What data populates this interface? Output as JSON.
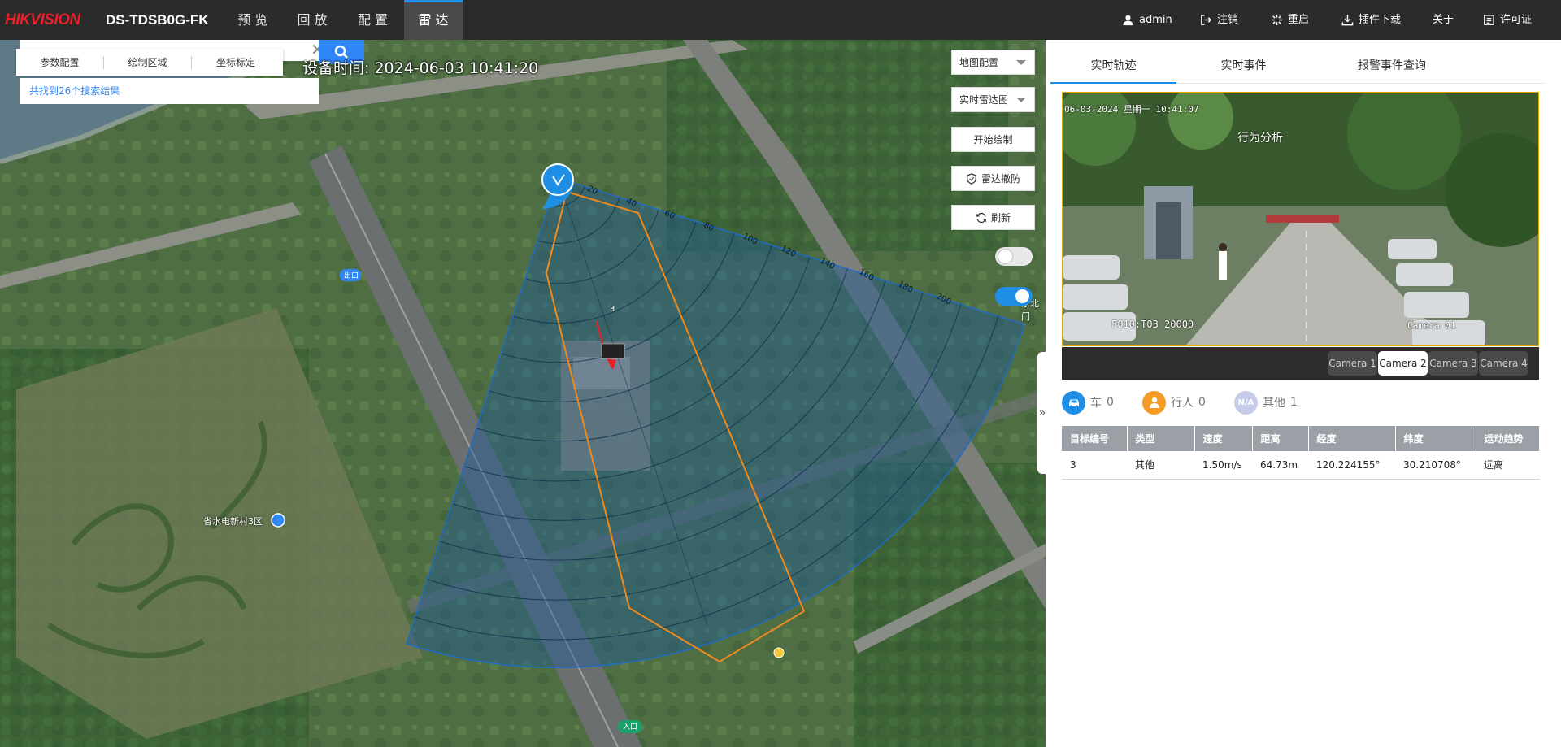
{
  "topbar": {
    "logo": "HIKVISION",
    "model": "DS-TDSB0G-FK",
    "tabs": [
      {
        "label": "预 览"
      },
      {
        "label": "回 放"
      },
      {
        "label": "配 置"
      },
      {
        "label": "雷 达"
      }
    ],
    "active_tab": "雷 达",
    "right": {
      "user": "admin",
      "logout": "注销",
      "reboot": "重启",
      "plugin": "插件下载",
      "about": "关于",
      "license": "许可证"
    }
  },
  "map": {
    "search": {
      "value": "",
      "placeholder": ""
    },
    "tools": [
      "参数配置",
      "绘制区域",
      "坐标标定"
    ],
    "results": "共找到26个搜索结果",
    "device_time": "设备时间: 2024-06-03 10:41:20",
    "controls": {
      "map_config": "地图配置",
      "radar_view": "实时雷达图",
      "start_draw": "开始绘制",
      "disarm": "雷达撤防",
      "refresh": "刷新"
    },
    "toggles": [
      {
        "state": "off"
      },
      {
        "state": "on"
      }
    ],
    "labels": {
      "exit": "出口",
      "entrance": "入口",
      "poi": "省水电新村3区",
      "north_gate": "东北门",
      "target_id": "3"
    },
    "ring_labels": [
      "20",
      "40",
      "60",
      "80",
      "100",
      "120",
      "140",
      "160",
      "180",
      "200"
    ],
    "colors": {
      "zone_fill": "#1e5a96",
      "zone_stroke": "#1f6cc4",
      "polygon": "#f08a1c",
      "target": "#e8202a"
    }
  },
  "panel": {
    "tabs": [
      "实时轨迹",
      "实时事件",
      "报警事件查询"
    ],
    "active_tab": "实时轨迹",
    "video": {
      "timestamp": "06-03-2024 星期一 10:41:07",
      "overlay_mid": "行为分析",
      "bottom_left": "F010:T03 20000",
      "camera_label": "Camera 01"
    },
    "cameras": [
      "Camera 1",
      "Camera 2",
      "Camera 3",
      "Camera 4"
    ],
    "active_camera": "Camera 2",
    "stats": [
      {
        "label": "车",
        "count": "0",
        "icon": "car-icon",
        "color": "#1f8fe5"
      },
      {
        "label": "行人",
        "count": "0",
        "icon": "person-icon",
        "color": "#f59a23"
      },
      {
        "label": "其他",
        "count": "1",
        "icon": "na-icon",
        "color": "#c5cbe8"
      }
    ],
    "table": {
      "headers": [
        "目标编号",
        "类型",
        "速度",
        "距离",
        "经度",
        "纬度",
        "运动趋势"
      ],
      "rows": [
        [
          "3",
          "其他",
          "1.50m/s",
          "64.73m",
          "120.224155°",
          "30.210708°",
          "远离"
        ]
      ]
    }
  }
}
